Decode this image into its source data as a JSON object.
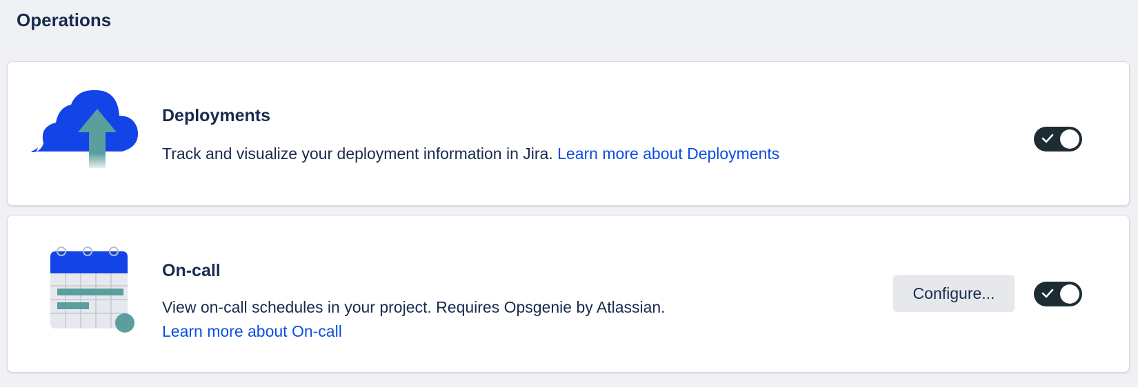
{
  "section": {
    "title": "Operations"
  },
  "features": [
    {
      "title": "Deployments",
      "description": "Track and visualize your deployment information in Jira. ",
      "link_label": "Learn more about Deployments",
      "enabled": true,
      "icon": "cloud-upload-icon"
    },
    {
      "title": "On-call",
      "description": "View on-call schedules in your project. Requires Opsgenie by Atlassian.",
      "link_label": "Learn more about On-call",
      "configure_label": "Configure...",
      "enabled": true,
      "icon": "calendar-icon"
    }
  ],
  "colors": {
    "toggle_on": "#1d2b33",
    "link": "#0c4fe0",
    "illustration_blue": "#1344e8",
    "illustration_teal": "#5a9e9e"
  }
}
